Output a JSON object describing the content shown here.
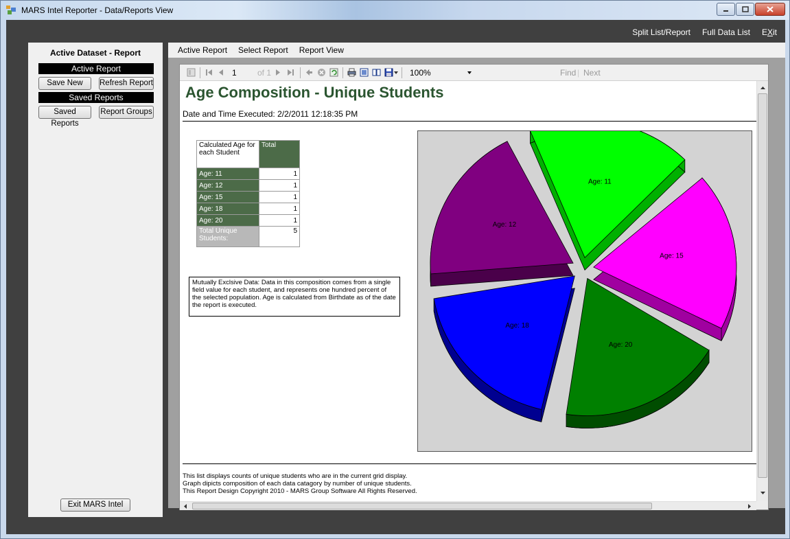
{
  "window": {
    "title": "MARS Intel Reporter - Data/Reports View"
  },
  "top_menu": {
    "split": "Split List/Report",
    "full": "Full Data List",
    "exit_prefix": "E",
    "exit_underlined": "X",
    "exit_suffix": "it"
  },
  "left_panel": {
    "title": "Active Dataset - Report",
    "active_report_header": "Active Report",
    "save_new": "Save New",
    "refresh_report": "Refresh Report",
    "saved_reports_header": "Saved Reports",
    "saved_reports_btn": "Saved Reports",
    "report_groups_btn": "Report Groups",
    "exit_btn": "Exit MARS Intel"
  },
  "main_menu": {
    "items": [
      "Active Report",
      "Select Report",
      "Report View"
    ]
  },
  "toolbar": {
    "page": "1",
    "of": "of 1",
    "zoom": "100%",
    "find": "Find",
    "next": "Next"
  },
  "report": {
    "title": "Age Composition - Unique Students",
    "subtitle": "Date and Time Executed: 2/2/2011 12:18:35 PM",
    "table": {
      "header_label": "Calculated Age for each Student",
      "header_total": "Total",
      "rows": [
        {
          "label": "Age: 11",
          "value": "1"
        },
        {
          "label": "Age: 12",
          "value": "1"
        },
        {
          "label": "Age: 15",
          "value": "1"
        },
        {
          "label": "Age: 18",
          "value": "1"
        },
        {
          "label": "Age: 20",
          "value": "1"
        }
      ],
      "total_label": "Total Unique Students:",
      "total_value": "5"
    },
    "note": "Mutually Exclsive Data: Data in this composition comes from a single field value for each student, and represents one hundred percent of the selected population.  Age is calculated from Birthdate as of the date the report is executed.",
    "footer": [
      "This list displays counts of unique students who are in the current grid display.",
      "Graph dipicts composition of each data catagory by number of unique students.",
      "This Report Design Copyright 2010 - MARS Group Software All Rights Reserved."
    ]
  },
  "chart_data": {
    "type": "pie",
    "categories": [
      "Age: 11",
      "Age: 15",
      "Age: 20",
      "Age: 18",
      "Age: 12"
    ],
    "values": [
      1,
      1,
      1,
      1,
      1
    ],
    "colors": [
      "#00ff00",
      "#ff00ff",
      "#008000",
      "#0000ff",
      "#800080"
    ],
    "side_colors": [
      "#00b000",
      "#a000a0",
      "#004d00",
      "#000090",
      "#4a004a"
    ],
    "exploded": true,
    "three_d": true
  }
}
